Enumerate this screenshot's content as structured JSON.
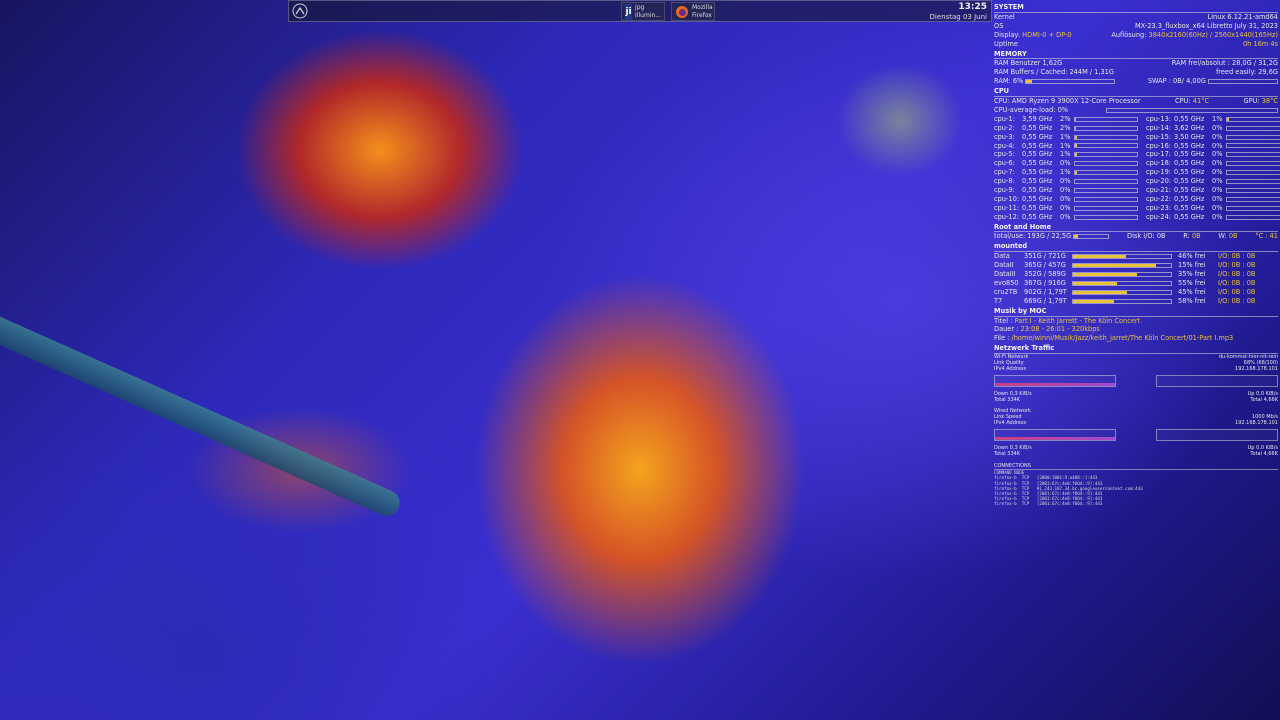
{
  "taskbar": {
    "menu_icon": "mx-logo-icon",
    "tasks": [
      {
        "icon": "ji",
        "line1": "jpg",
        "line2": "Illumin..."
      },
      {
        "icon": "firefox-icon",
        "line1": "Mozilla",
        "line2": "Firefox"
      }
    ],
    "time": "13:25",
    "date": "Dienstag 03 Juni"
  },
  "system": {
    "title": "SYSTEM",
    "kernel_label": "Kernel",
    "kernel": "Linux 6.12.21-amd64",
    "os_label": "OS",
    "os": "MX-23.3_fluxbox_x64 Libretto July 31, 2023",
    "display_label": "Display:",
    "display": "HDMI-0  +  DP-0",
    "resolution_label": "Auflösung:",
    "resolution": "3840x2160(60Hz) / 2560x1440(165Hz)",
    "uptime_label": "Uptime",
    "uptime": "0h 16m 4s"
  },
  "memory": {
    "title": "MEMORY",
    "ram_user": "RAM Benutzer 1,62G",
    "ram_free": "RAM frei/absolut : 28,0G / 31,2G",
    "ram_buffers": "RAM Buffers / Cached:  244M / 1,31G",
    "freed": "freed easily: 29,6G",
    "ram_pct": "RAM: 6%",
    "ram_frac": 0.06,
    "swap": "SWAP : 0B/ 4,00G",
    "swap_frac": 0.0
  },
  "cpu": {
    "title": "CPU",
    "model": "CPU: AMD Ryzen 9 3900X 12-Core Processor",
    "cpu_temp_label": "CPU:",
    "cpu_temp": "41°C",
    "gpu_temp_label": "GPU:",
    "gpu_temp": "38°C",
    "avg_load": "CPU-average-load: 0%",
    "cores": [
      {
        "n": "cpu-1:",
        "f": "3,59 GHz",
        "p": "2%",
        "v": 0.02
      },
      {
        "n": "cpu-2:",
        "f": "0,55 GHz",
        "p": "2%",
        "v": 0.02
      },
      {
        "n": "cpu-3:",
        "f": "0,55 GHz",
        "p": "1%",
        "v": 0.01
      },
      {
        "n": "cpu-4:",
        "f": "0,55 GHz",
        "p": "1%",
        "v": 0.01
      },
      {
        "n": "cpu-5:",
        "f": "0,55 GHz",
        "p": "1%",
        "v": 0.01
      },
      {
        "n": "cpu-6:",
        "f": "0,55 GHz",
        "p": "0%",
        "v": 0
      },
      {
        "n": "cpu-7:",
        "f": "0,55 GHz",
        "p": "1%",
        "v": 0.01
      },
      {
        "n": "cpu-8:",
        "f": "0,55 GHz",
        "p": "0%",
        "v": 0
      },
      {
        "n": "cpu-9:",
        "f": "0,55 GHz",
        "p": "0%",
        "v": 0
      },
      {
        "n": "cpu-10:",
        "f": "0,55 GHz",
        "p": "0%",
        "v": 0
      },
      {
        "n": "cpu-11:",
        "f": "0,55 GHz",
        "p": "0%",
        "v": 0
      },
      {
        "n": "cpu-12:",
        "f": "0,55 GHz",
        "p": "0%",
        "v": 0
      },
      {
        "n": "cpu-13:",
        "f": "0,55 GHz",
        "p": "1%",
        "v": 0.01
      },
      {
        "n": "cpu-14:",
        "f": "3,62 GHz",
        "p": "0%",
        "v": 0
      },
      {
        "n": "cpu-15:",
        "f": "3,50 GHz",
        "p": "0%",
        "v": 0
      },
      {
        "n": "cpu-16:",
        "f": "0,55 GHz",
        "p": "0%",
        "v": 0
      },
      {
        "n": "cpu-17:",
        "f": "0,55 GHz",
        "p": "0%",
        "v": 0
      },
      {
        "n": "cpu-18:",
        "f": "0,55 GHz",
        "p": "0%",
        "v": 0
      },
      {
        "n": "cpu-19:",
        "f": "0,55 GHz",
        "p": "0%",
        "v": 0
      },
      {
        "n": "cpu-20:",
        "f": "0,55 GHz",
        "p": "0%",
        "v": 0
      },
      {
        "n": "cpu-21:",
        "f": "0,55 GHz",
        "p": "0%",
        "v": 0
      },
      {
        "n": "cpu-22:",
        "f": "0,55 GHz",
        "p": "0%",
        "v": 0
      },
      {
        "n": "cpu-23:",
        "f": "0,55 GHz",
        "p": "0%",
        "v": 0
      },
      {
        "n": "cpu-24:",
        "f": "0,55 GHz",
        "p": "0%",
        "v": 0
      }
    ]
  },
  "root": {
    "title": "Root and Home",
    "total": "total/use: 193G / 22,5G",
    "use_frac": 0.12,
    "disk_io": "Disk I/O: 0B",
    "r_label": "R:",
    "r": "0B",
    "w_label": "W:",
    "w": "0B",
    "temp": "°C : 41"
  },
  "mounted": {
    "title": "mounted",
    "rows": [
      {
        "name": "Data",
        "size": "351G / 721G",
        "frac": 0.54,
        "free": "46% frei",
        "io": "I/O:  0B  :  0B"
      },
      {
        "name": "DataII",
        "size": "365G / 457G",
        "frac": 0.85,
        "free": "15% frei",
        "io": "I/O:  0B  :  0B"
      },
      {
        "name": "DataIII",
        "size": "352G / 589G",
        "frac": 0.65,
        "free": "35% frei",
        "io": "I/O:  0B  :  0B"
      },
      {
        "name": "evo850",
        "size": "367G / 916G",
        "frac": 0.45,
        "free": "55% frei",
        "io": "I/O:  0B  :  0B"
      },
      {
        "name": "cru2TB",
        "size": "902G / 1,79T",
        "frac": 0.55,
        "free": "45% frei",
        "io": "I/O:  0B  :  0B"
      },
      {
        "name": "T7",
        "size": "669G / 1,79T",
        "frac": 0.42,
        "free": "58% frei",
        "io": "I/O:  0B  :  0B"
      }
    ]
  },
  "music": {
    "title": "Musik by MOC",
    "titel_label": "Titel  :",
    "titel": "Part I - Keith Jarrett - The Köln Concert",
    "dauer_label": "Dauer  :",
    "dauer": "23:08 - 26:01 - 320kbps",
    "file_label": "File   :",
    "file": "/home/winni/Musik/Jazz/keith_jarret/The Köln Concert/01-Part I.mp3"
  },
  "network": {
    "title": "Netzwerk Traffic",
    "wifi": {
      "label1": "Wi-Fi Network",
      "value1": "du-kommst-hier-nit-rein",
      "label2": "Link Quality",
      "value2": "68% (68/100)",
      "label3": "IPv4 Address",
      "value3": "192.168.178.101",
      "down": "Down 0,3 KiB/s",
      "up": "Up 0,0 KiB/s",
      "total_down": "Total 334K",
      "total_up": "Total 4,66K"
    },
    "wired": {
      "label1": "Wired Network",
      "label2": "Link Speed",
      "value2": "1000 Mb/s",
      "label3": "IPv4 Address",
      "value3": "192.168.178.101",
      "down": "Down 0,3 KiB/s",
      "up": "Up 0,0 KiB/s",
      "total_down": "Total 334K",
      "total_up": "Total 4,66K"
    }
  },
  "connections": {
    "title": "CONNECTIONS",
    "header": "COMMAND    NODE",
    "lines": [
      "firefox-b  TCP   [2000:1001:9:a408::]:443",
      "firefox-b  TCP   [2001:67c:4e8:f004::9]:443",
      "firefox-b  TCP   91.243.187.34.bc.googleusercontent.com:443",
      "firefox-b  TCP   [2001:67c:4e8:f004::9]:443",
      "firefox-b  TCP   [2001:67c:4e8:f004::9]:443",
      "firefox-b  TCP   [2001:67c:4e8:f004::9]:443"
    ]
  }
}
